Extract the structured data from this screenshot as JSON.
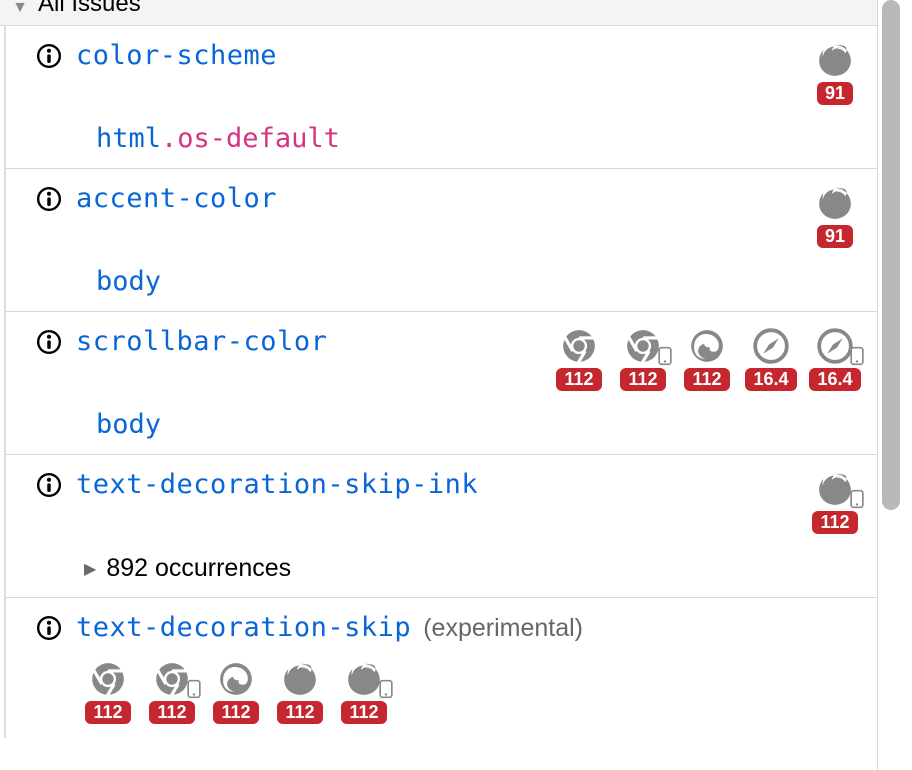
{
  "section": {
    "title": "All Issues"
  },
  "issues": [
    {
      "property": "color-scheme",
      "note": "",
      "selector": {
        "element": "html",
        "class": ".os-default"
      },
      "occurrences": null,
      "browsers": [
        {
          "browser": "firefox",
          "mobile": false,
          "version": "91"
        }
      ],
      "browsers_below": false
    },
    {
      "property": "accent-color",
      "note": "",
      "selector": {
        "element": "body",
        "class": ""
      },
      "occurrences": null,
      "browsers": [
        {
          "browser": "firefox",
          "mobile": false,
          "version": "91"
        }
      ],
      "browsers_below": false
    },
    {
      "property": "scrollbar-color",
      "note": "",
      "selector": {
        "element": "body",
        "class": ""
      },
      "occurrences": null,
      "browsers": [
        {
          "browser": "chrome",
          "mobile": false,
          "version": "112"
        },
        {
          "browser": "chrome",
          "mobile": true,
          "version": "112"
        },
        {
          "browser": "edge",
          "mobile": false,
          "version": "112"
        },
        {
          "browser": "safari",
          "mobile": false,
          "version": "16.4"
        },
        {
          "browser": "safari",
          "mobile": true,
          "version": "16.4"
        }
      ],
      "browsers_below": false
    },
    {
      "property": "text-decoration-skip-ink",
      "note": "",
      "selector": null,
      "occurrences": "892 occurrences",
      "browsers": [
        {
          "browser": "firefox",
          "mobile": true,
          "version": "112"
        }
      ],
      "browsers_below": false
    },
    {
      "property": "text-decoration-skip",
      "note": "(experimental)",
      "selector": null,
      "occurrences": null,
      "browsers": [
        {
          "browser": "chrome",
          "mobile": false,
          "version": "112"
        },
        {
          "browser": "chrome",
          "mobile": true,
          "version": "112"
        },
        {
          "browser": "edge",
          "mobile": false,
          "version": "112"
        },
        {
          "browser": "firefox",
          "mobile": false,
          "version": "112"
        },
        {
          "browser": "firefox",
          "mobile": true,
          "version": "112"
        }
      ],
      "browsers_below": true
    }
  ]
}
